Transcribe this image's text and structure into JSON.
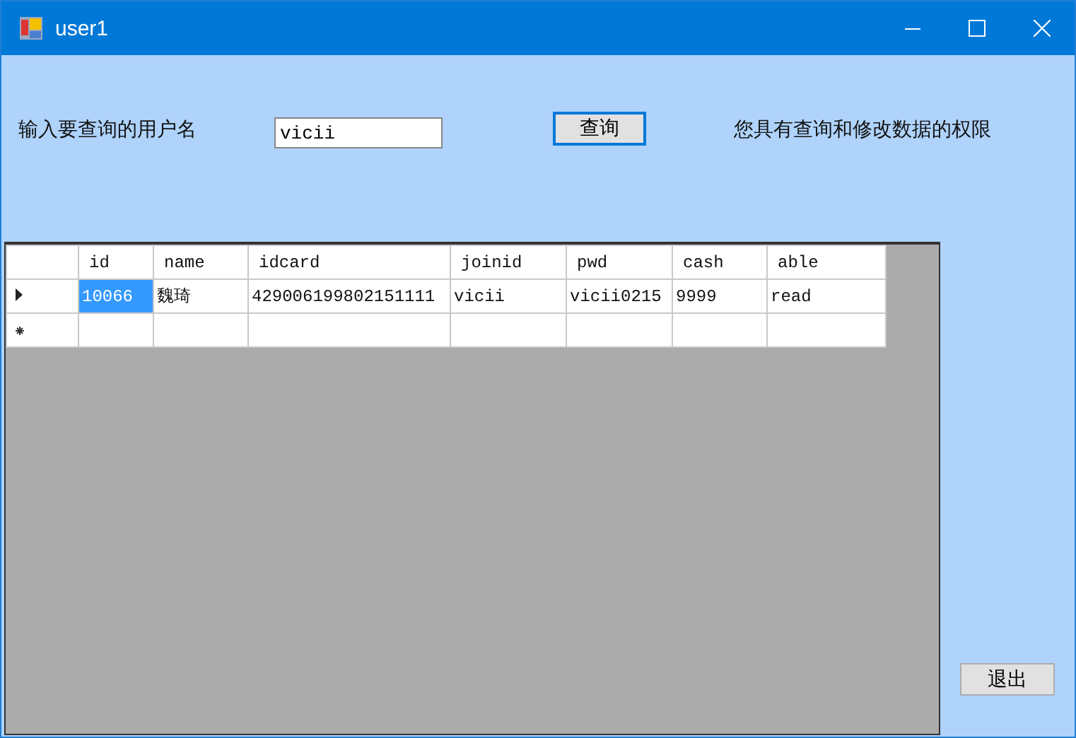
{
  "window": {
    "title": "user1"
  },
  "search": {
    "label": "输入要查询的用户名",
    "value": "vicii",
    "button": "查询"
  },
  "permission_note": "您具有查询和修改数据的权限",
  "table": {
    "columns": [
      "id",
      "name",
      "idcard",
      "joinid",
      "pwd",
      "cash",
      "able"
    ],
    "rows": [
      {
        "kind": "data",
        "current": true,
        "cells": [
          {
            "text": "10066",
            "selected": true
          },
          {
            "text": "魏琦",
            "selected": false
          },
          {
            "text": "429006199802151111",
            "selected": false
          },
          {
            "text": "vicii",
            "selected": false
          },
          {
            "text": "vicii0215",
            "selected": false
          },
          {
            "text": "9999",
            "selected": false
          },
          {
            "text": "read",
            "selected": false
          }
        ]
      },
      {
        "kind": "new",
        "current": false
      }
    ]
  },
  "exit_button": "退出"
}
